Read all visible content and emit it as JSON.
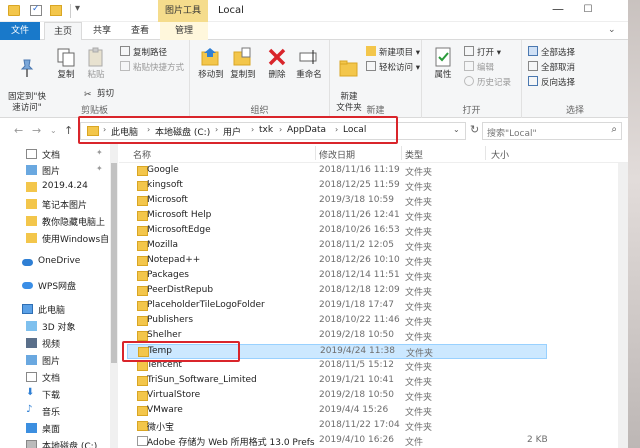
{
  "title_bar": {
    "context_tab_header": "图片工具",
    "title": "Local"
  },
  "tabs": [
    {
      "label": "文件"
    },
    {
      "label": "主页"
    },
    {
      "label": "共享"
    },
    {
      "label": "查看"
    },
    {
      "label": "管理"
    }
  ],
  "ribbon": {
    "clipboard": {
      "pin_quick_access": "固定到\"快\n速访问\"",
      "copy": "复制",
      "paste": "粘贴",
      "copy_path": "复制路径",
      "paste_shortcut": "粘贴快捷方式",
      "cut": "剪切",
      "group_label": "剪贴板"
    },
    "organize": {
      "move_to": "移动到",
      "copy_to": "复制到",
      "delete": "删除",
      "rename": "重命名",
      "group_label": "组织"
    },
    "new": {
      "new_folder": "新建\n文件夹",
      "new_item": "新建项目",
      "easy_access": "轻松访问",
      "group_label": "新建"
    },
    "open": {
      "properties": "属性",
      "open": "打开",
      "edit": "编辑",
      "history": "历史记录",
      "group_label": "打开"
    },
    "select": {
      "select_all": "全部选择",
      "select_none": "全部取消",
      "invert": "反向选择",
      "group_label": "选择"
    }
  },
  "address": {
    "crumbs": [
      "此电脑",
      "本地磁盘 (C:)",
      "用户",
      "txk",
      "AppData",
      "Local"
    ],
    "search_placeholder": "搜索\"Local\""
  },
  "sidebar": {
    "items": [
      {
        "label": "文档",
        "icon": "document-icon"
      },
      {
        "label": "图片",
        "icon": "picture-icon"
      },
      {
        "label": "2019.4.24",
        "icon": "folder-icon"
      },
      {
        "label": "笔记本图片",
        "icon": "folder-icon"
      },
      {
        "label": "教你隐藏电脑上",
        "icon": "folder-icon"
      },
      {
        "label": "使用Windows自",
        "icon": "folder-icon"
      },
      {
        "label": "OneDrive",
        "icon": "cloud-icon"
      },
      {
        "label": "WPS网盘",
        "icon": "cloud-icon"
      },
      {
        "label": "此电脑",
        "icon": "computer-icon"
      },
      {
        "label": "3D 对象",
        "icon": "cube-icon"
      },
      {
        "label": "视频",
        "icon": "video-icon"
      },
      {
        "label": "图片",
        "icon": "picture-icon"
      },
      {
        "label": "文档",
        "icon": "document-icon"
      },
      {
        "label": "下载",
        "icon": "download-icon"
      },
      {
        "label": "音乐",
        "icon": "music-icon"
      },
      {
        "label": "桌面",
        "icon": "desktop-icon"
      },
      {
        "label": "本地磁盘 (C:)",
        "icon": "drive-icon"
      }
    ]
  },
  "columns": {
    "name": "名称",
    "date": "修改日期",
    "type": "类型",
    "size": "大小"
  },
  "files": [
    {
      "name": "Google",
      "date": "2018/11/16 11:19",
      "type": "文件夹",
      "size": ""
    },
    {
      "name": "kingsoft",
      "date": "2018/12/25 11:59",
      "type": "文件夹",
      "size": ""
    },
    {
      "name": "Microsoft",
      "date": "2019/3/18 10:59",
      "type": "文件夹",
      "size": ""
    },
    {
      "name": "Microsoft Help",
      "date": "2018/11/26 12:41",
      "type": "文件夹",
      "size": ""
    },
    {
      "name": "MicrosoftEdge",
      "date": "2018/10/26 16:53",
      "type": "文件夹",
      "size": ""
    },
    {
      "name": "Mozilla",
      "date": "2018/11/2 12:05",
      "type": "文件夹",
      "size": ""
    },
    {
      "name": "Notepad++",
      "date": "2018/12/26 10:10",
      "type": "文件夹",
      "size": ""
    },
    {
      "name": "Packages",
      "date": "2018/12/14 11:51",
      "type": "文件夹",
      "size": ""
    },
    {
      "name": "PeerDistRepub",
      "date": "2018/12/18 12:09",
      "type": "文件夹",
      "size": ""
    },
    {
      "name": "PlaceholderTileLogoFolder",
      "date": "2019/1/18 17:47",
      "type": "文件夹",
      "size": ""
    },
    {
      "name": "Publishers",
      "date": "2018/10/22 11:46",
      "type": "文件夹",
      "size": ""
    },
    {
      "name": "Shelher",
      "date": "2019/2/18 10:50",
      "type": "文件夹",
      "size": ""
    },
    {
      "name": "Temp",
      "date": "2019/4/24 11:38",
      "type": "文件夹",
      "size": ""
    },
    {
      "name": "Tencent",
      "date": "2018/11/5 15:12",
      "type": "文件夹",
      "size": ""
    },
    {
      "name": "TriSun_Software_Limited",
      "date": "2019/1/21 10:41",
      "type": "文件夹",
      "size": ""
    },
    {
      "name": "VirtualStore",
      "date": "2019/2/18 10:50",
      "type": "文件夹",
      "size": ""
    },
    {
      "name": "VMware",
      "date": "2019/4/4 15:26",
      "type": "文件夹",
      "size": ""
    },
    {
      "name": "微小宝",
      "date": "2018/11/22 17:04",
      "type": "文件夹",
      "size": ""
    },
    {
      "name": "Adobe 存储为 Web 所用格式 13.0 Prefs",
      "date": "2019/4/10 16:26",
      "type": "文件",
      "size": "2 KB"
    }
  ],
  "colors": {
    "file_tab": "#1979ca",
    "selection": "#cce8ff",
    "annotation": "#d9252b",
    "folder": "#f3c64b"
  }
}
